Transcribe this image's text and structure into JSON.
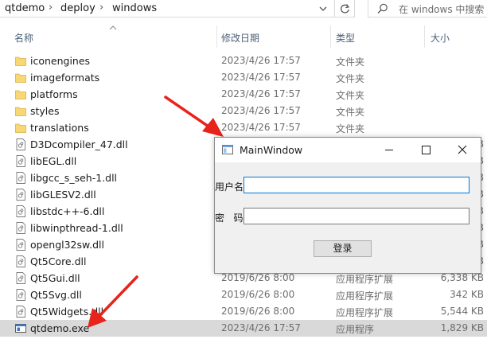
{
  "address_bar": {
    "crumbs": [
      "qtdemo",
      "deploy",
      "windows"
    ],
    "search_placeholder": "在 windows 中搜索"
  },
  "columns": {
    "name": "名称",
    "date": "修改日期",
    "type": "类型",
    "size": "大小"
  },
  "files": [
    {
      "name": "iconengines",
      "date": "2023/4/26 17:57",
      "type": "文件夹",
      "size": "",
      "kind": "folder"
    },
    {
      "name": "imageformats",
      "date": "2023/4/26 17:57",
      "type": "文件夹",
      "size": "",
      "kind": "folder"
    },
    {
      "name": "platforms",
      "date": "2023/4/26 17:57",
      "type": "文件夹",
      "size": "",
      "kind": "folder"
    },
    {
      "name": "styles",
      "date": "2023/4/26 17:57",
      "type": "文件夹",
      "size": "",
      "kind": "folder"
    },
    {
      "name": "translations",
      "date": "2023/4/26 17:57",
      "type": "文件夹",
      "size": "",
      "kind": "folder"
    },
    {
      "name": "D3Dcompiler_47.dll",
      "date": "",
      "type": "",
      "size": "KB",
      "kind": "dll"
    },
    {
      "name": "libEGL.dll",
      "date": "",
      "type": "",
      "size": "KB",
      "kind": "dll"
    },
    {
      "name": "libgcc_s_seh-1.dll",
      "date": "",
      "type": "",
      "size": "KB",
      "kind": "dll"
    },
    {
      "name": "libGLESV2.dll",
      "date": "",
      "type": "",
      "size": "KB",
      "kind": "dll"
    },
    {
      "name": "libstdc++-6.dll",
      "date": "",
      "type": "",
      "size": "KB",
      "kind": "dll"
    },
    {
      "name": "libwinpthread-1.dll",
      "date": "",
      "type": "",
      "size": "KB",
      "kind": "dll"
    },
    {
      "name": "opengl32sw.dll",
      "date": "",
      "type": "",
      "size": "KB",
      "kind": "dll"
    },
    {
      "name": "Qt5Core.dll",
      "date": "",
      "type": "",
      "size": "KB",
      "kind": "dll"
    },
    {
      "name": "Qt5Gui.dll",
      "date": "2019/6/26 8:00",
      "type": "应用程序扩展",
      "size": "6,338 KB",
      "kind": "dll"
    },
    {
      "name": "Qt5Svg.dll",
      "date": "2019/6/26 8:00",
      "type": "应用程序扩展",
      "size": "342 KB",
      "kind": "dll"
    },
    {
      "name": "Qt5Widgets.dll",
      "date": "2019/6/26 8:00",
      "type": "应用程序扩展",
      "size": "5,544 KB",
      "kind": "dll"
    },
    {
      "name": "qtdemo.exe",
      "date": "2023/4/26 17:57",
      "type": "应用程序",
      "size": "1,829 KB",
      "kind": "exe",
      "selected": true
    }
  ],
  "qt_window": {
    "title": "MainWindow",
    "username_label": "用户名",
    "password_label": "密   码",
    "username_value": "",
    "password_value": "",
    "login_button": "登录"
  },
  "colors": {
    "accent": "#0078d7",
    "folder": "#f8d775",
    "arrow": "#e8231b",
    "selected_row": "#d9d9d9"
  }
}
